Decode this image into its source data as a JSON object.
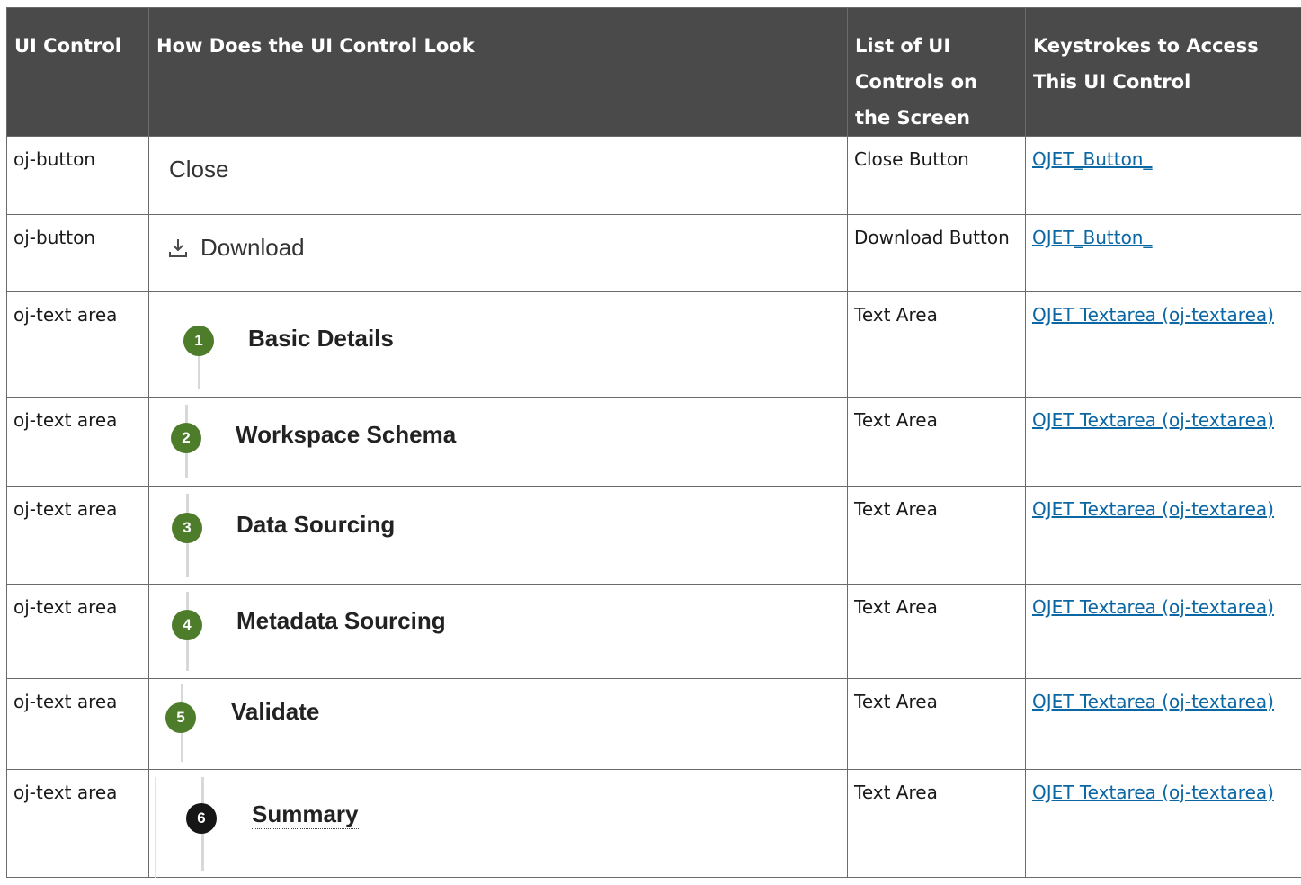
{
  "headers": [
    "UI Control",
    "How Does the UI Control Look",
    "List of UI Controls on the Screen",
    "Keystrokes to Access This UI Control"
  ],
  "rows": [
    {
      "control": "oj-button",
      "look_text": "Close",
      "list": "Close Button",
      "keystroke": "OJET_Button_"
    },
    {
      "control": "oj-button",
      "look_text": "Download",
      "list": "Download Button",
      "keystroke": "OJET_Button_"
    },
    {
      "control": "oj-text area",
      "step_number": "1",
      "look_text": "Basic Details",
      "list": "Text Area",
      "keystroke": "OJET Textarea (oj-textarea)"
    },
    {
      "control": "oj-text area",
      "step_number": "2",
      "look_text": "Workspace Schema",
      "list": "Text Area",
      "keystroke": "OJET Textarea (oj-textarea)"
    },
    {
      "control": "oj-text area",
      "step_number": "3",
      "look_text": "Data Sourcing",
      "list": "Text Area",
      "keystroke": "OJET Textarea (oj-textarea)"
    },
    {
      "control": "oj-text area",
      "step_number": "4",
      "look_text": "Metadata Sourcing",
      "list": "Text Area",
      "keystroke": "OJET Textarea (oj-textarea)"
    },
    {
      "control": "oj-text area",
      "step_number": "5",
      "look_text": "Validate",
      "list": "Text Area",
      "keystroke": "OJET Textarea (oj-textarea)"
    },
    {
      "control": "oj-text area",
      "step_number": "6",
      "look_text": "Summary",
      "list": "Text Area",
      "keystroke": "OJET Textarea (oj-textarea)"
    }
  ],
  "colors": {
    "header_bg": "#4a4a4a",
    "step_green": "#4d7c2a",
    "step_active": "#161616",
    "link": "#0b66a4"
  },
  "icons": {
    "download": "download-icon"
  }
}
